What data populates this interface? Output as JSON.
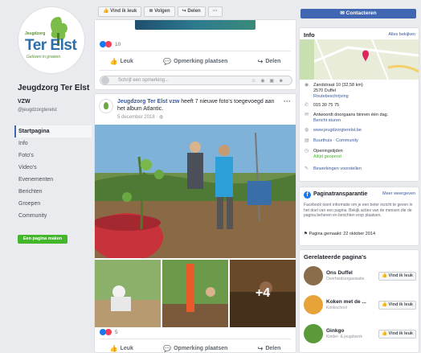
{
  "page": {
    "logo_sub": "Jeugdzorg",
    "logo_main": "Ter Elst",
    "logo_tag": "Geloven in groeien",
    "name": "Jeugdzorg Ter Elst",
    "category": "VZW",
    "handle": "@jeugdzorgterelst"
  },
  "nav": [
    {
      "label": "Startpagina",
      "active": true
    },
    {
      "label": "Info"
    },
    {
      "label": "Foto's"
    },
    {
      "label": "Video's"
    },
    {
      "label": "Evenementen"
    },
    {
      "label": "Berichten"
    },
    {
      "label": "Groepen"
    },
    {
      "label": "Community"
    }
  ],
  "create_page": "Een pagina maken",
  "topbar": {
    "like": "Vind ik leuk",
    "follow": "Volgen",
    "share": "Delen",
    "more": "···"
  },
  "post1": {
    "reaction_count": "10",
    "like": "Leuk",
    "comment": "Opmerking plaatsen",
    "share": "Delen",
    "comment_placeholder": "Schrijf een opmerking..."
  },
  "post2": {
    "author": "Jeugdzorg Ter Elst vzw",
    "text": " heeft 7 nieuwe foto's toegevoegd aan het album Atlantic.",
    "date": "5 december 2018 · ",
    "more_photos": "+4",
    "reaction_count": "5",
    "like": "Leuk",
    "comment": "Opmerking plaatsen",
    "share": "Delen"
  },
  "right": {
    "contact_button": "Contacteren",
    "info_title": "Info",
    "info_link": "Alles bekijken",
    "address": "Zandstraat 10 (32,58 km)",
    "city": "2570 Duffel",
    "route": "Routebeschrijving",
    "phone": "015 30 75 75",
    "response": "Antwoordt doorgaans binnen één dag.",
    "send_message": "Bericht sturen",
    "website": "www.jeugdzorgterelst.be",
    "type": "Buurthuis · Community",
    "hours_label": "Openingstijden",
    "hours_status": "Altijd geopend",
    "suggest": "Bewerkingen voorstellen",
    "transparency_title": "Paginatransparantie",
    "transparency_link": "Meer weergeven",
    "transparency_text": "Facebook toont informatie om je een beter inzicht te geven in het doel van een pagina. Bekijk acties van de mensen die de pagina beheren en berichten erop plaatsen.",
    "created": "Pagina gemaakt: 22 oktober 2014",
    "related_title": "Gerelateerde pagina's",
    "related": [
      {
        "name": "Ons Duffel",
        "category": "Overheidsorganisatie",
        "button": "Vind ik leuk",
        "color": "#8a6d4a"
      },
      {
        "name": "Koken met de ...",
        "category": "Kookschool",
        "button": "Vind ik leuk",
        "color": "#e8a23a"
      },
      {
        "name": "Ginkgo",
        "category": "Kinder- & jeugdwerk",
        "button": "Vind ik leuk",
        "color": "#5a9a3a"
      }
    ]
  }
}
